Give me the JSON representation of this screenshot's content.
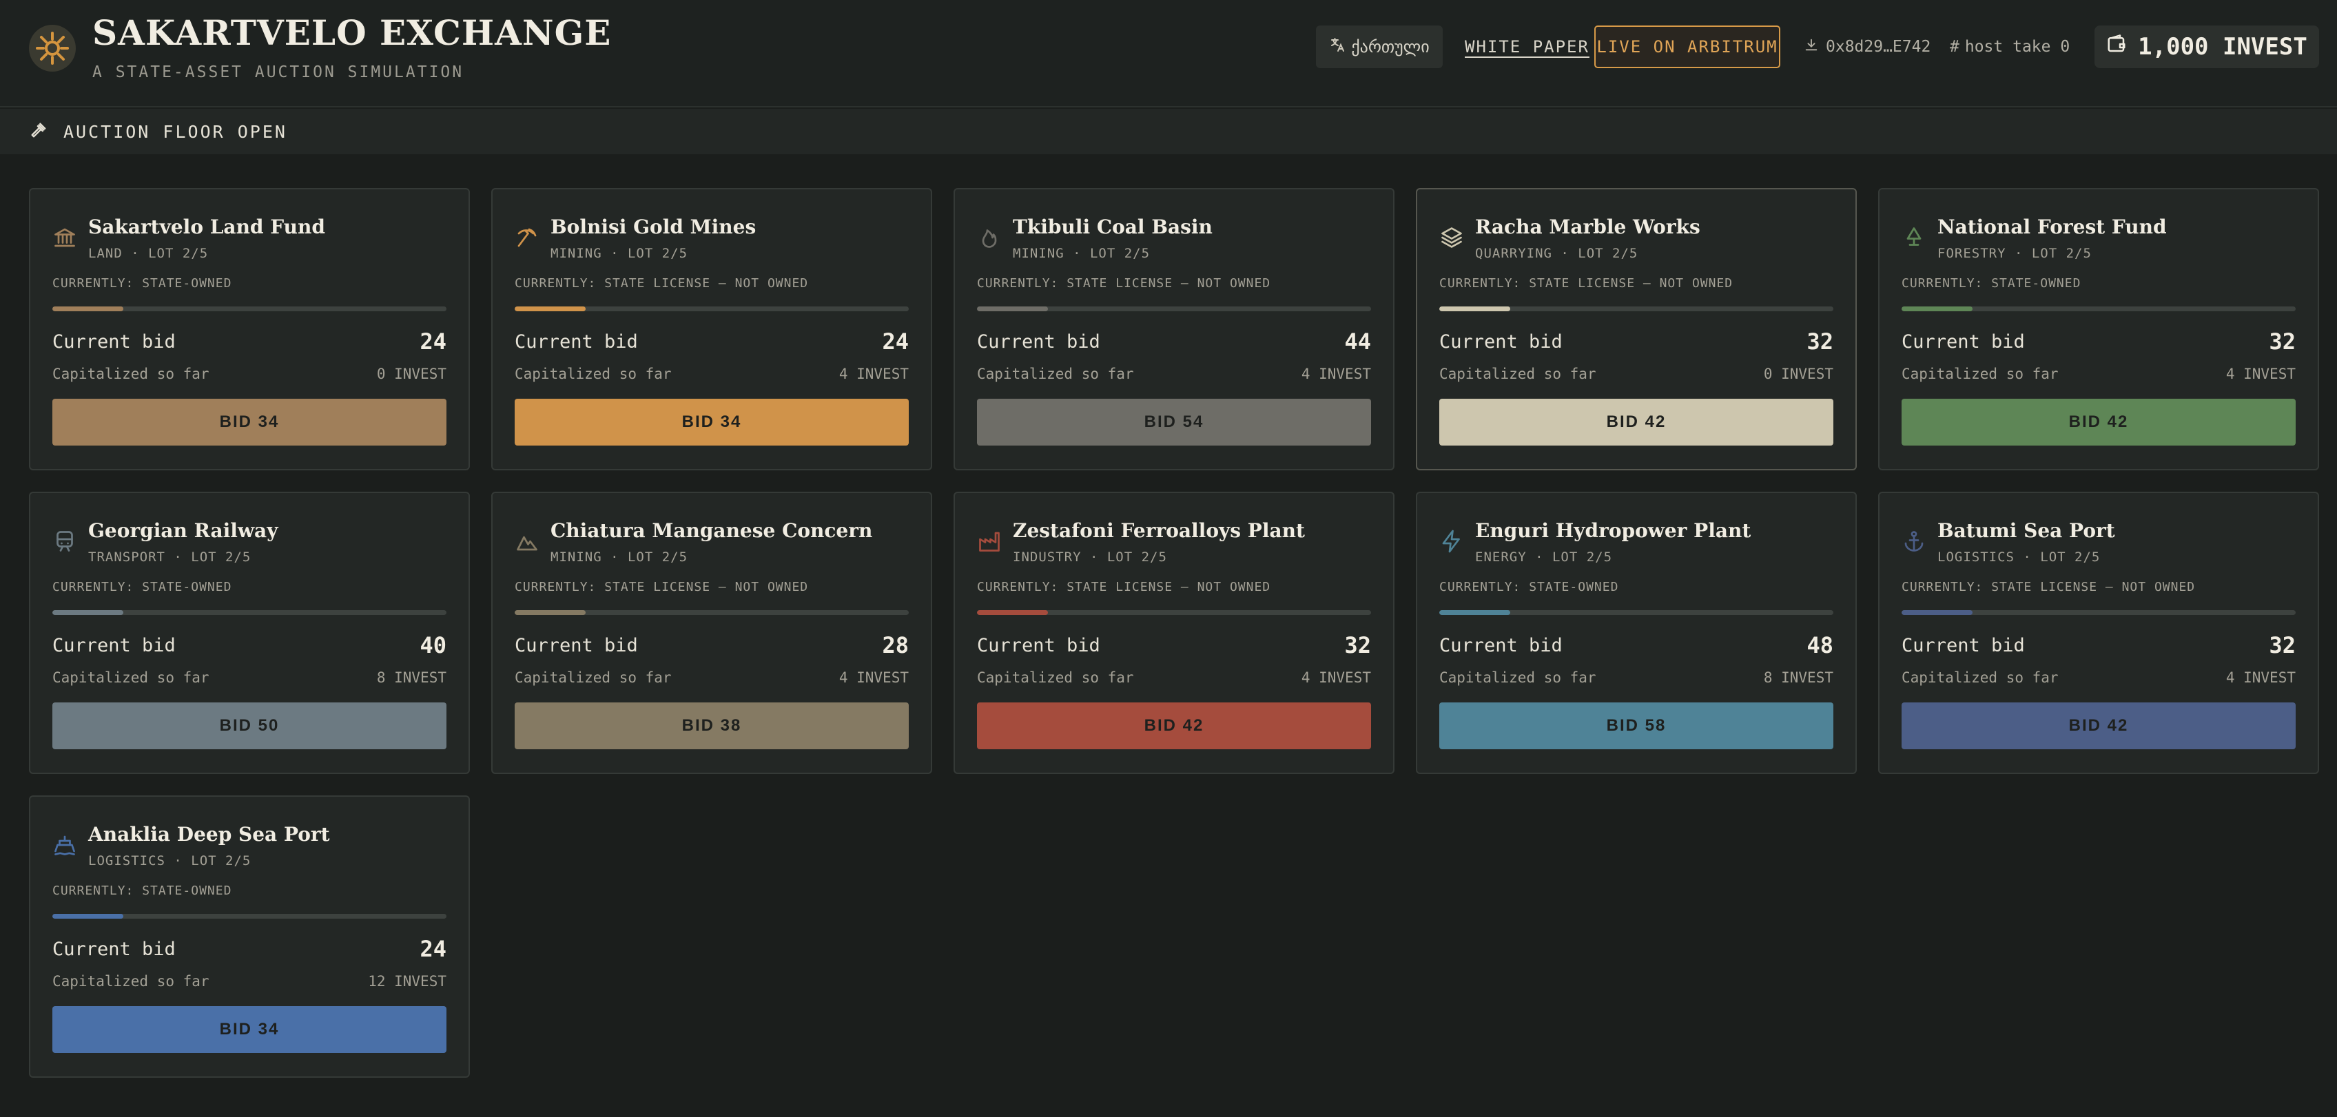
{
  "header": {
    "title": "SAKARTVELO EXCHANGE",
    "subtitle": "A STATE-ASSET AUCTION SIMULATION",
    "language_label": "ქართული",
    "white_paper_label": "WHITE PAPER",
    "arbitrum_label": "LIVE ON ARBITRUM",
    "wallet_address": "0x8d29…E742",
    "host_take_label": "host take 0",
    "invest_balance": "1,000 INVEST"
  },
  "banner": {
    "label": "AUCTION FLOOR OPEN"
  },
  "labels": {
    "current_bid": "Current bid",
    "capitalized": "Capitalized so far"
  },
  "colors": {
    "background": "#1b1e1c",
    "card": "#232725",
    "accent": "#d79a48"
  },
  "cards": [
    {
      "title": "Sakartvelo Land Fund",
      "sector": "LAND · LOT 2/5",
      "status": "CURRENTLY: STATE-OWNED",
      "progress": 0.18,
      "current_bid": "24",
      "capitalized": "0 INVEST",
      "bid_label": "BID 34",
      "color": "#a07f5a",
      "icon": "bank-icon"
    },
    {
      "title": "Bolnisi Gold Mines",
      "sector": "MINING · LOT 2/5",
      "status": "CURRENTLY: STATE LICENSE — NOT OWNED",
      "progress": 0.18,
      "current_bid": "24",
      "capitalized": "4 INVEST",
      "bid_label": "BID 34",
      "color": "#d0934a",
      "icon": "pickaxe-icon"
    },
    {
      "title": "Tkibuli Coal Basin",
      "sector": "MINING · LOT 2/5",
      "status": "CURRENTLY: STATE LICENSE — NOT OWNED",
      "progress": 0.18,
      "current_bid": "44",
      "capitalized": "4 INVEST",
      "bid_label": "BID 54",
      "color": "#6e6d67",
      "icon": "flame-icon"
    },
    {
      "title": "Racha Marble Works",
      "sector": "QUARRYING · LOT 2/5",
      "status": "CURRENTLY: STATE LICENSE — NOT OWNED",
      "progress": 0.18,
      "current_bid": "32",
      "capitalized": "0 INVEST",
      "bid_label": "BID 42",
      "color": "#cdc6ae",
      "icon": "layers-icon",
      "active": true
    },
    {
      "title": "National Forest Fund",
      "sector": "FORESTRY · LOT 2/5",
      "status": "CURRENTLY: STATE-OWNED",
      "progress": 0.18,
      "current_bid": "32",
      "capitalized": "4 INVEST",
      "bid_label": "BID 42",
      "color": "#5e8656",
      "icon": "tree-icon"
    },
    {
      "title": "Georgian Railway",
      "sector": "TRANSPORT · LOT 2/5",
      "status": "CURRENTLY: STATE-OWNED",
      "progress": 0.18,
      "current_bid": "40",
      "capitalized": "8 INVEST",
      "bid_label": "BID 50",
      "color": "#6c7a82",
      "icon": "train-icon"
    },
    {
      "title": "Chiatura Manganese Concern",
      "sector": "MINING · LOT 2/5",
      "status": "CURRENTLY: STATE LICENSE — NOT OWNED",
      "progress": 0.18,
      "current_bid": "28",
      "capitalized": "4 INVEST",
      "bid_label": "BID 38",
      "color": "#857a63",
      "icon": "mountain-icon"
    },
    {
      "title": "Zestafoni Ferroalloys Plant",
      "sector": "INDUSTRY · LOT 2/5",
      "status": "CURRENTLY: STATE LICENSE — NOT OWNED",
      "progress": 0.18,
      "current_bid": "32",
      "capitalized": "4 INVEST",
      "bid_label": "BID 42",
      "color": "#a54c3d",
      "icon": "factory-icon"
    },
    {
      "title": "Enguri Hydropower Plant",
      "sector": "ENERGY · LOT 2/5",
      "status": "CURRENTLY: STATE-OWNED",
      "progress": 0.18,
      "current_bid": "48",
      "capitalized": "8 INVEST",
      "bid_label": "BID 58",
      "color": "#4f8397",
      "icon": "bolt-icon"
    },
    {
      "title": "Batumi Sea Port",
      "sector": "LOGISTICS · LOT 2/5",
      "status": "CURRENTLY: STATE LICENSE — NOT OWNED",
      "progress": 0.18,
      "current_bid": "32",
      "capitalized": "4 INVEST",
      "bid_label": "BID 42",
      "color": "#4c5e87",
      "icon": "anchor-icon"
    },
    {
      "title": "Anaklia Deep Sea Port",
      "sector": "LOGISTICS · LOT 2/5",
      "status": "CURRENTLY: STATE-OWNED",
      "progress": 0.18,
      "current_bid": "24",
      "capitalized": "12 INVEST",
      "bid_label": "BID 34",
      "color": "#4a70a8",
      "icon": "ship-icon"
    }
  ]
}
